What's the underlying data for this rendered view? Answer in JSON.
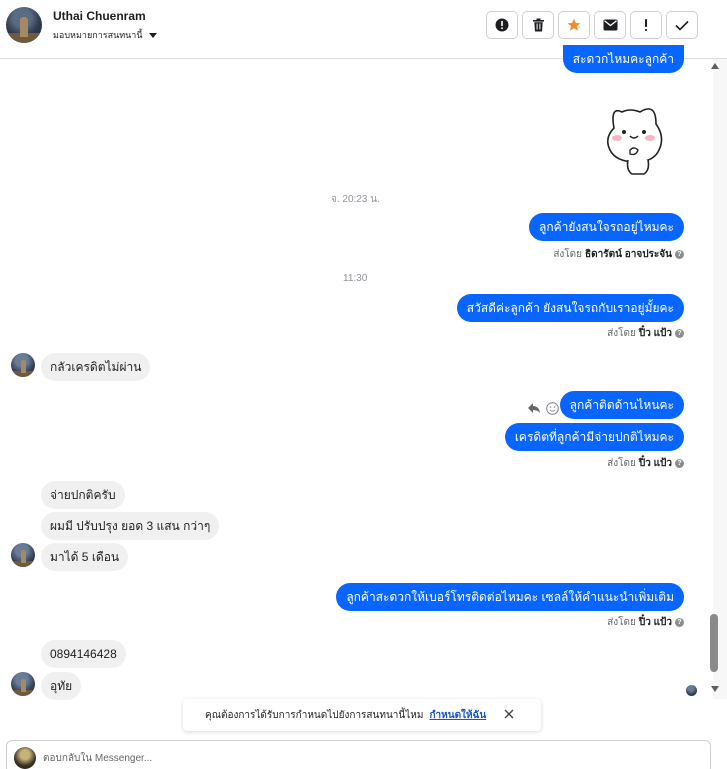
{
  "header": {
    "contact_name": "Uthai Chuenram",
    "assign_label": "มอบหมายการสนทนานี้",
    "actions": [
      {
        "name": "alert-icon"
      },
      {
        "name": "trash-icon"
      },
      {
        "name": "star-icon"
      },
      {
        "name": "mail-icon"
      },
      {
        "name": "exclamation-icon"
      },
      {
        "name": "check-icon"
      }
    ]
  },
  "colors": {
    "outgoing_bubble": "#0866ff",
    "incoming_bubble": "#f0f0f0",
    "star_accent": "#f28c28",
    "link": "#1a55c9"
  },
  "messages": {
    "top_partial": "สะดวกไหมคะลูกค้า",
    "time_1": "จ. 20:23 น.",
    "out_1": "ลูกค้ายังสนใจรถอยู่ไหมคะ",
    "sent_by_1_prefix": "ส่งโดย",
    "sent_by_1_name": "ธิดารัตน์ อาจประจัน",
    "time_2": "11:30",
    "out_2": "สวัสดีค่ะลูกค้า ยังสนใจรถกับเราอยู่มั้ยคะ",
    "sent_by_2_prefix": "ส่งโดย",
    "sent_by_2_name": "ปิ๋ว แป้ว",
    "in_1": "กลัวเครดิตไม่ผ่าน",
    "out_3": "ลูกค้าติดด้านไหนคะ",
    "out_4": "เครดิตที่ลูกค้ามีจ่ายปกติไหมคะ",
    "sent_by_3_prefix": "ส่งโดย",
    "sent_by_3_name": "ปิ๋ว แป้ว",
    "in_2": "จ่ายปกติครับ",
    "in_3": "ผมมี ปรับปรุง ยอด 3 แสน กว่าๆ",
    "in_4": "มาได้ 5 เดือน",
    "out_5": "ลูกค้าสะดวกให้เบอร์โทรติดต่อไหมคะ เซลล์ให้คำแนะนำเพิ่มเติม",
    "sent_by_4_prefix": "ส่งโดย",
    "sent_by_4_name": "ปิ๋ว แป้ว",
    "in_5": "0894146428",
    "in_6": "อุทัย",
    "info_glyph": "?"
  },
  "banner": {
    "text": "คุณต้องการได้รับการกำหนดไปยังการสนทนานี้ไหม",
    "link": "กำหนดให้ฉัน"
  },
  "composer": {
    "placeholder": "ตอบกลับใน Messenger..."
  }
}
